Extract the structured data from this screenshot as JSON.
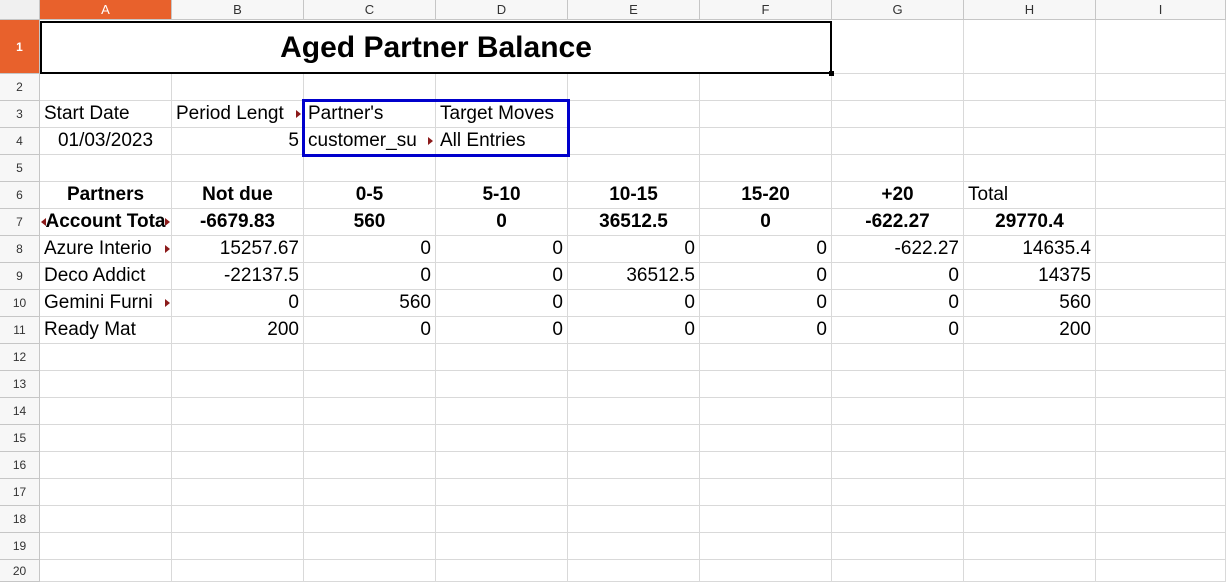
{
  "columns": [
    "A",
    "B",
    "C",
    "D",
    "E",
    "F",
    "G",
    "H",
    "I"
  ],
  "selected_column": "A",
  "rows": [
    "1",
    "2",
    "3",
    "4",
    "5",
    "6",
    "7",
    "8",
    "9",
    "10",
    "11",
    "12",
    "13",
    "14",
    "15",
    "16",
    "17",
    "18",
    "19",
    "20"
  ],
  "selected_row": "1",
  "report": {
    "title": "Aged Partner Balance",
    "start_date_label": "Start Date",
    "period_length_label": "Period Lengt",
    "partners_label": "Partner's",
    "target_moves_label": "Target Moves",
    "start_date": "01/03/2023",
    "period_length": "5",
    "partners_value": "customer_su",
    "target_moves_value": "All Entries"
  },
  "headers": [
    "Partners",
    "Not due",
    "0-5",
    "5-10",
    "10-15",
    "15-20",
    "+20",
    "Total"
  ],
  "account_total": {
    "label": "Account Tota",
    "values": [
      "-6679.83",
      "560",
      "0",
      "36512.5",
      "0",
      "-622.27",
      "29770.4"
    ]
  },
  "partners": [
    {
      "name": "Azure Interio",
      "values": [
        "15257.67",
        "0",
        "0",
        "0",
        "0",
        "-622.27",
        "14635.4"
      ]
    },
    {
      "name": "Deco Addict",
      "values": [
        "-22137.5",
        "0",
        "0",
        "36512.5",
        "0",
        "0",
        "14375"
      ]
    },
    {
      "name": "Gemini Furni",
      "values": [
        "0",
        "560",
        "0",
        "0",
        "0",
        "0",
        "560"
      ]
    },
    {
      "name": "Ready Mat",
      "values": [
        "200",
        "0",
        "0",
        "0",
        "0",
        "0",
        "200"
      ]
    }
  ],
  "colors": {
    "selection_header": "#e8612c",
    "selection_box": "#0000cc",
    "comment_marker": "#8b1a1a"
  }
}
